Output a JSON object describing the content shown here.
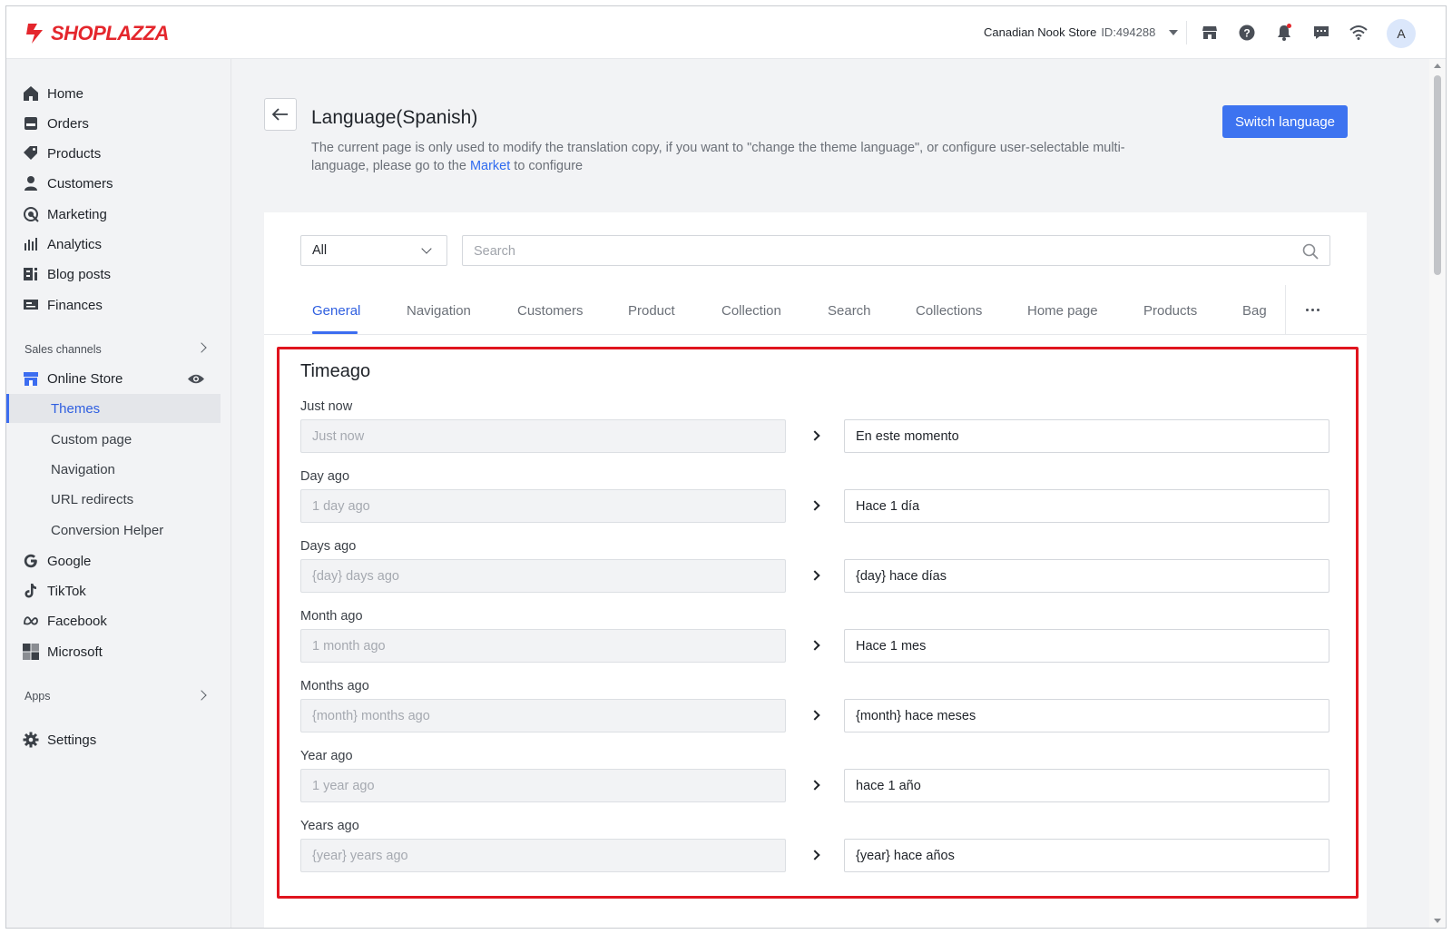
{
  "app": {
    "logo_text": "SHOPLAZZA",
    "store_name": "Canadian Nook Store",
    "store_id": "ID:494288",
    "avatar_initial": "A",
    "brand_color": "#e4262c",
    "accent_color": "#3d73f0",
    "topbar_icons": [
      "store-icon",
      "help-icon",
      "bell-icon",
      "chat-icon",
      "wifi-icon"
    ]
  },
  "sidebar": {
    "items": [
      {
        "label": "Home",
        "icon": "home-icon"
      },
      {
        "label": "Orders",
        "icon": "orders-icon"
      },
      {
        "label": "Products",
        "icon": "tag-icon"
      },
      {
        "label": "Customers",
        "icon": "person-icon"
      },
      {
        "label": "Marketing",
        "icon": "marketing-icon"
      },
      {
        "label": "Analytics",
        "icon": "bar-chart-icon"
      },
      {
        "label": "Blog posts",
        "icon": "blog-icon"
      },
      {
        "label": "Finances",
        "icon": "finances-icon"
      }
    ],
    "sales_channels_label": "Sales channels",
    "online_store": {
      "label": "Online Store",
      "icon": "storefront-icon"
    },
    "online_store_sub": [
      "Themes",
      "Custom page",
      "Navigation",
      "URL redirects",
      "Conversion Helper"
    ],
    "channels": [
      {
        "label": "Google",
        "icon": "google-icon"
      },
      {
        "label": "TikTok",
        "icon": "tiktok-icon"
      },
      {
        "label": "Facebook",
        "icon": "meta-icon"
      },
      {
        "label": "Microsoft",
        "icon": "microsoft-icon"
      }
    ],
    "apps_label": "Apps",
    "settings_label": "Settings"
  },
  "header": {
    "title": "Language(Spanish)",
    "desc_before": "The current page is only used to modify the translation copy, if you want to \"change the theme language\", or configure user-selectable multi-language, please go to the ",
    "desc_link": "Market",
    "desc_after": " to configure",
    "switch_button": "Switch language"
  },
  "filter": {
    "select_value": "All",
    "search_placeholder": "Search"
  },
  "tabs": [
    "General",
    "Navigation",
    "Customers",
    "Product",
    "Collection",
    "Search",
    "Collections",
    "Home page",
    "Products",
    "Bag"
  ],
  "section": {
    "title": "Timeago",
    "rows": [
      {
        "label": "Just now",
        "source": "Just now",
        "translation": "En este momento"
      },
      {
        "label": "Day ago",
        "source": "1 day ago",
        "translation": "Hace 1 día"
      },
      {
        "label": "Days ago",
        "source": "{day} days ago",
        "translation": "{day} hace días"
      },
      {
        "label": "Month ago",
        "source": "1 month ago",
        "translation": "Hace 1 mes"
      },
      {
        "label": "Months ago",
        "source": "{month} months ago",
        "translation": "{month} hace meses"
      },
      {
        "label": "Year ago",
        "source": "1 year ago",
        "translation": "hace 1 año"
      },
      {
        "label": "Years ago",
        "source": "{year} years ago",
        "translation": "{year} hace años"
      }
    ]
  }
}
